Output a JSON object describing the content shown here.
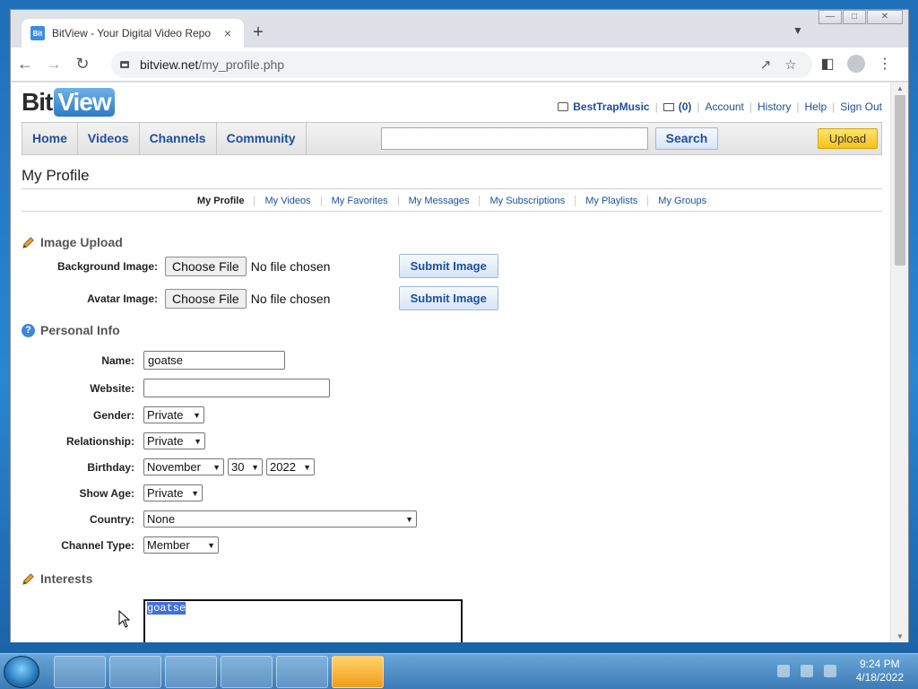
{
  "browser": {
    "tab_title": "BitView - Your Digital Video Repo",
    "tab_close": "×",
    "new_tab": "+",
    "url_host": "bitview.net",
    "url_path": "/my_profile.php",
    "icons": [
      "back-icon",
      "forward-icon",
      "reload-icon",
      "lock-icon",
      "share-icon",
      "star-icon",
      "sidebar-icon",
      "profile-icon",
      "menu-icon"
    ]
  },
  "site": {
    "logo_bit": "Bit",
    "logo_view": "View",
    "username": "BestTrapMusic",
    "msg_count": "(0)",
    "links": [
      "Account",
      "History",
      "Help",
      "Sign Out"
    ],
    "nav": [
      "Home",
      "Videos",
      "Channels",
      "Community"
    ],
    "search_value": "",
    "search_label": "Search",
    "upload_label": "Upload"
  },
  "page": {
    "title": "My Profile",
    "subnav": [
      "My Profile",
      "My Videos",
      "My Favorites",
      "My Messages",
      "My Subscriptions",
      "My Playlists",
      "My Groups"
    ]
  },
  "image_upload": {
    "heading": "Image Upload",
    "background_label": "Background Image:",
    "avatar_label": "Avatar Image:",
    "choose_file": "Choose File",
    "no_file": "No file chosen",
    "submit": "Submit Image"
  },
  "personal_info": {
    "heading": "Personal Info",
    "name_label": "Name:",
    "name_value": "goatse",
    "website_label": "Website:",
    "website_value": "",
    "gender_label": "Gender:",
    "gender_value": "Private",
    "relationship_label": "Relationship:",
    "relationship_value": "Private",
    "birthday_label": "Birthday:",
    "birthday_month": "November",
    "birthday_day": "30",
    "birthday_year": "2022",
    "show_age_label": "Show Age:",
    "show_age_value": "Private",
    "country_label": "Country:",
    "country_value": "None",
    "channel_type_label": "Channel Type:",
    "channel_type_value": "Member"
  },
  "interests": {
    "heading": "Interests",
    "value": "goatse"
  },
  "taskbar": {
    "time": "9:24 PM",
    "date": "4/18/2022"
  }
}
